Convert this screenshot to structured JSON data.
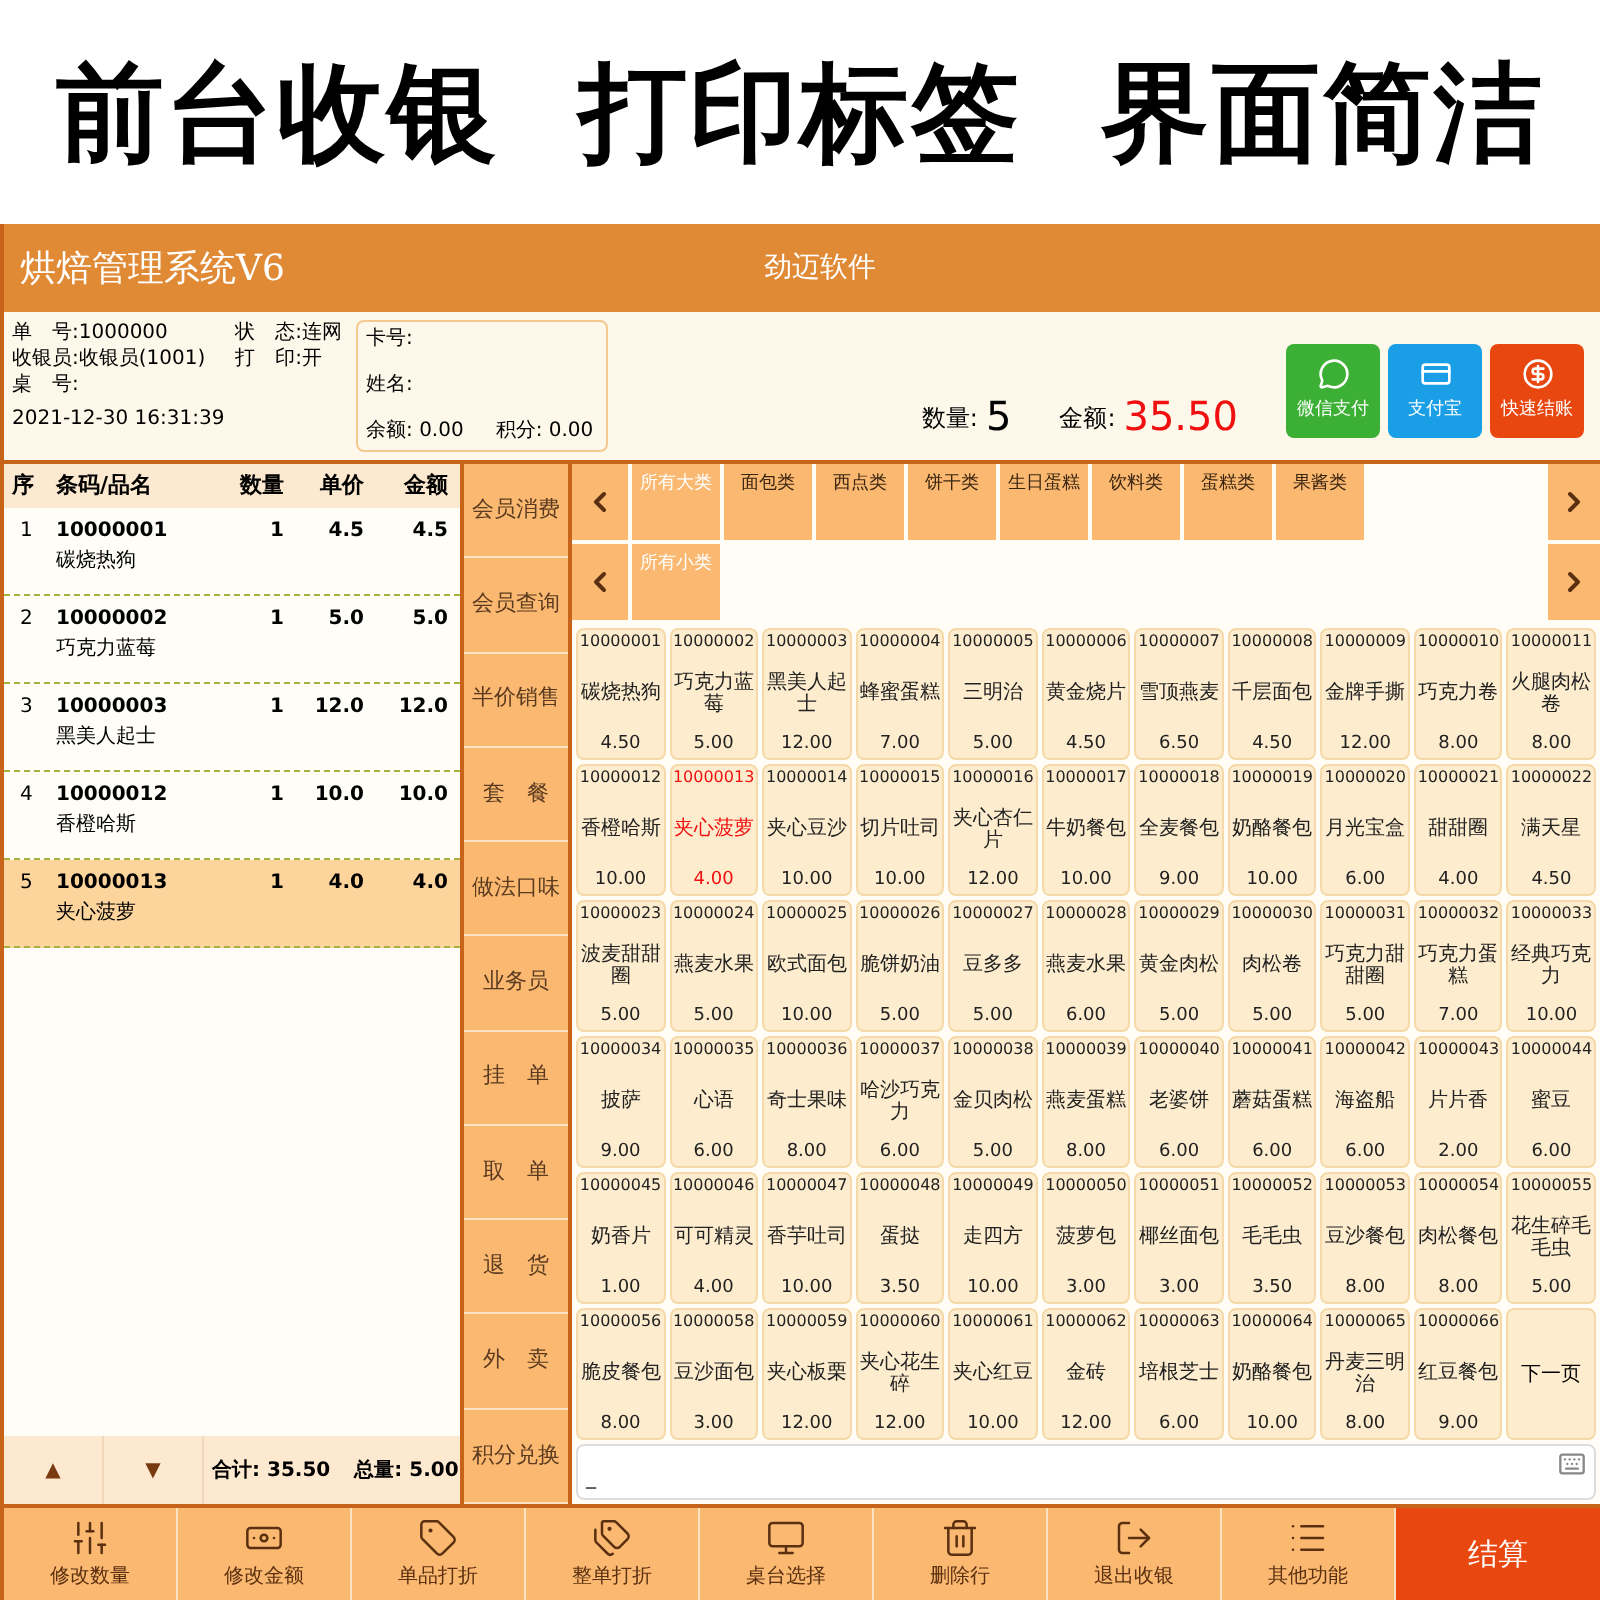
{
  "banner": {
    "headline": [
      "前台收银",
      "打印标签",
      "界面简洁"
    ]
  },
  "window": {
    "title": "烘焙管理系统V6",
    "subtitle": "劲迈软件"
  },
  "order_info": {
    "fields": [
      {
        "label": "单　号:",
        "value": "1000000"
      },
      {
        "label": "状　态:",
        "value": "连网"
      },
      {
        "label": "收银员:",
        "value": "收银员(1001)"
      },
      {
        "label": "打　印:",
        "value": "开"
      },
      {
        "label": "桌　号:"
      }
    ],
    "datetime": "2021-12-30 16:31:39"
  },
  "member": {
    "card_label": "卡号:",
    "name_label": "姓名:",
    "balance_label": "余额:",
    "balance": "0.00",
    "points_label": "积分:",
    "points": "0.00"
  },
  "totals": {
    "qty_label": "数量:",
    "qty": "5",
    "amount_label": "金额:",
    "amount": "35.50"
  },
  "payments": [
    {
      "label": "微信支付",
      "kind": "wechat",
      "color": "#3cb034"
    },
    {
      "label": "支付宝",
      "kind": "alipay",
      "color": "#1a9ee6"
    },
    {
      "label": "快速结账",
      "kind": "quick",
      "color": "#e8470f"
    }
  ],
  "order_table": {
    "columns": [
      "序",
      "条码/品名",
      "数量",
      "单价",
      "金额"
    ],
    "rows": [
      {
        "no": "1",
        "code": "10000001",
        "name": "碳烧热狗",
        "qty": "1",
        "price": "4.5",
        "amount": "4.5",
        "selected": false
      },
      {
        "no": "2",
        "code": "10000002",
        "name": "巧克力蓝莓",
        "qty": "1",
        "price": "5.0",
        "amount": "5.0",
        "selected": false
      },
      {
        "no": "3",
        "code": "10000003",
        "name": "黑美人起士",
        "qty": "1",
        "price": "12.0",
        "amount": "12.0",
        "selected": false
      },
      {
        "no": "4",
        "code": "10000012",
        "name": "香橙哈斯",
        "qty": "1",
        "price": "10.0",
        "amount": "10.0",
        "selected": false
      },
      {
        "no": "5",
        "code": "10000013",
        "name": "夹心菠萝",
        "qty": "1",
        "price": "4.0",
        "amount": "4.0",
        "selected": true
      }
    ],
    "footer": {
      "up": "▲",
      "down": "▼",
      "sum": "合计: 35.50",
      "total_qty": "总量: 5.00"
    }
  },
  "side_buttons": [
    "会员消费",
    "会员查询",
    "半价销售",
    "套　餐",
    "做法口味",
    "业务员",
    "挂　单",
    "取　单",
    "退　货",
    "外　卖",
    "积分兑换"
  ],
  "categories": [
    {
      "label": "所有大类",
      "selected": true
    },
    {
      "label": "面包类",
      "selected": false
    },
    {
      "label": "西点类",
      "selected": false
    },
    {
      "label": "饼干类",
      "selected": false
    },
    {
      "label": "生日蛋糕",
      "selected": false
    },
    {
      "label": "饮料类",
      "selected": false
    },
    {
      "label": "蛋糕类",
      "selected": false
    },
    {
      "label": "果酱类",
      "selected": false
    }
  ],
  "subcategories": [
    {
      "label": "所有小类",
      "selected": true
    }
  ],
  "products": [
    {
      "code": "10000001",
      "name": "碳烧热狗",
      "price": "4.50",
      "selected": false
    },
    {
      "code": "10000002",
      "name": "巧克力蓝莓",
      "price": "5.00",
      "selected": false
    },
    {
      "code": "10000003",
      "name": "黑美人起士",
      "price": "12.00",
      "selected": false
    },
    {
      "code": "10000004",
      "name": "蜂蜜蛋糕",
      "price": "7.00",
      "selected": false
    },
    {
      "code": "10000005",
      "name": "三明治",
      "price": "5.00",
      "selected": false
    },
    {
      "code": "10000006",
      "name": "黄金烧片",
      "price": "4.50",
      "selected": false
    },
    {
      "code": "10000007",
      "name": "雪顶燕麦",
      "price": "6.50",
      "selected": false
    },
    {
      "code": "10000008",
      "name": "千层面包",
      "price": "4.50",
      "selected": false
    },
    {
      "code": "10000009",
      "name": "金牌手撕",
      "price": "12.00",
      "selected": false
    },
    {
      "code": "10000010",
      "name": "巧克力卷",
      "price": "8.00",
      "selected": false
    },
    {
      "code": "10000011",
      "name": "火腿肉松卷",
      "price": "8.00",
      "selected": false
    },
    {
      "code": "10000012",
      "name": "香橙哈斯",
      "price": "10.00",
      "selected": false
    },
    {
      "code": "10000013",
      "name": "夹心菠萝",
      "price": "4.00",
      "selected": true
    },
    {
      "code": "10000014",
      "name": "夹心豆沙",
      "price": "10.00",
      "selected": false
    },
    {
      "code": "10000015",
      "name": "切片吐司",
      "price": "10.00",
      "selected": false
    },
    {
      "code": "10000016",
      "name": "夹心杏仁片",
      "price": "12.00",
      "selected": false
    },
    {
      "code": "10000017",
      "name": "牛奶餐包",
      "price": "10.00",
      "selected": false
    },
    {
      "code": "10000018",
      "name": "全麦餐包",
      "price": "9.00",
      "selected": false
    },
    {
      "code": "10000019",
      "name": "奶酪餐包",
      "price": "10.00",
      "selected": false
    },
    {
      "code": "10000020",
      "name": "月光宝盒",
      "price": "6.00",
      "selected": false
    },
    {
      "code": "10000021",
      "name": "甜甜圈",
      "price": "4.00",
      "selected": false
    },
    {
      "code": "10000022",
      "name": "满天星",
      "price": "4.50",
      "selected": false
    },
    {
      "code": "10000023",
      "name": "波麦甜甜圈",
      "price": "5.00",
      "selected": false
    },
    {
      "code": "10000024",
      "name": "燕麦水果",
      "price": "5.00",
      "selected": false
    },
    {
      "code": "10000025",
      "name": "欧式面包",
      "price": "10.00",
      "selected": false
    },
    {
      "code": "10000026",
      "name": "脆饼奶油",
      "price": "5.00",
      "selected": false
    },
    {
      "code": "10000027",
      "name": "豆多多",
      "price": "5.00",
      "selected": false
    },
    {
      "code": "10000028",
      "name": "燕麦水果",
      "price": "6.00",
      "selected": false
    },
    {
      "code": "10000029",
      "name": "黄金肉松",
      "price": "5.00",
      "selected": false
    },
    {
      "code": "10000030",
      "name": "肉松卷",
      "price": "5.00",
      "selected": false
    },
    {
      "code": "10000031",
      "name": "巧克力甜甜圈",
      "price": "5.00",
      "selected": false
    },
    {
      "code": "10000032",
      "name": "巧克力蛋糕",
      "price": "7.00",
      "selected": false
    },
    {
      "code": "10000033",
      "name": "经典巧克力",
      "price": "10.00",
      "selected": false
    },
    {
      "code": "10000034",
      "name": "披萨",
      "price": "9.00",
      "selected": false
    },
    {
      "code": "10000035",
      "name": "心语",
      "price": "6.00",
      "selected": false
    },
    {
      "code": "10000036",
      "name": "奇士果味",
      "price": "8.00",
      "selected": false
    },
    {
      "code": "10000037",
      "name": "哈沙巧克力",
      "price": "6.00",
      "selected": false
    },
    {
      "code": "10000038",
      "name": "金贝肉松",
      "price": "5.00",
      "selected": false
    },
    {
      "code": "10000039",
      "name": "燕麦蛋糕",
      "price": "8.00",
      "selected": false
    },
    {
      "code": "10000040",
      "name": "老婆饼",
      "price": "6.00",
      "selected": false
    },
    {
      "code": "10000041",
      "name": "蘑菇蛋糕",
      "price": "6.00",
      "selected": false
    },
    {
      "code": "10000042",
      "name": "海盗船",
      "price": "6.00",
      "selected": false
    },
    {
      "code": "10000043",
      "name": "片片香",
      "price": "2.00",
      "selected": false
    },
    {
      "code": "10000044",
      "name": "蜜豆",
      "price": "6.00",
      "selected": false
    },
    {
      "code": "10000045",
      "name": "奶香片",
      "price": "1.00",
      "selected": false
    },
    {
      "code": "10000046",
      "name": "可可精灵",
      "price": "4.00",
      "selected": false
    },
    {
      "code": "10000047",
      "name": "香芋吐司",
      "price": "10.00",
      "selected": false
    },
    {
      "code": "10000048",
      "name": "蛋挞",
      "price": "3.50",
      "selected": false
    },
    {
      "code": "10000049",
      "name": "走四方",
      "price": "10.00",
      "selected": false
    },
    {
      "code": "10000050",
      "name": "菠萝包",
      "price": "3.00",
      "selected": false
    },
    {
      "code": "10000051",
      "name": "椰丝面包",
      "price": "3.00",
      "selected": false
    },
    {
      "code": "10000052",
      "name": "毛毛虫",
      "price": "3.50",
      "selected": false
    },
    {
      "code": "10000053",
      "name": "豆沙餐包",
      "price": "8.00",
      "selected": false
    },
    {
      "code": "10000054",
      "name": "肉松餐包",
      "price": "8.00",
      "selected": false
    },
    {
      "code": "10000055",
      "name": "花生碎毛毛虫",
      "price": "5.00",
      "selected": false
    },
    {
      "code": "10000056",
      "name": "脆皮餐包",
      "price": "8.00",
      "selected": false
    },
    {
      "code": "10000058",
      "name": "豆沙面包",
      "price": "3.00",
      "selected": false
    },
    {
      "code": "10000059",
      "name": "夹心板栗",
      "price": "12.00",
      "selected": false
    },
    {
      "code": "10000060",
      "name": "夹心花生碎",
      "price": "12.00",
      "selected": false
    },
    {
      "code": "10000061",
      "name": "夹心红豆",
      "price": "10.00",
      "selected": false
    },
    {
      "code": "10000062",
      "name": "金砖",
      "price": "12.00",
      "selected": false
    },
    {
      "code": "10000063",
      "name": "培根芝士",
      "price": "6.00",
      "selected": false
    },
    {
      "code": "10000064",
      "name": "奶酪餐包",
      "price": "10.00",
      "selected": false
    },
    {
      "code": "10000065",
      "name": "丹麦三明治",
      "price": "8.00",
      "selected": false
    },
    {
      "code": "10000066",
      "name": "红豆餐包",
      "price": "9.00",
      "selected": false
    }
  ],
  "next_page": "下一页",
  "input": {
    "value": "_"
  },
  "toolbar": [
    {
      "label": "修改数量",
      "kind": "sliders"
    },
    {
      "label": "修改金额",
      "kind": "money"
    },
    {
      "label": "单品打折",
      "kind": "tag"
    },
    {
      "label": "整单打折",
      "kind": "tags"
    },
    {
      "label": "桌台选择",
      "kind": "monitor"
    },
    {
      "label": "删除行",
      "kind": "trash"
    },
    {
      "label": "退出收银",
      "kind": "exit"
    },
    {
      "label": "其他功能",
      "kind": "list"
    }
  ],
  "checkout": "结算"
}
